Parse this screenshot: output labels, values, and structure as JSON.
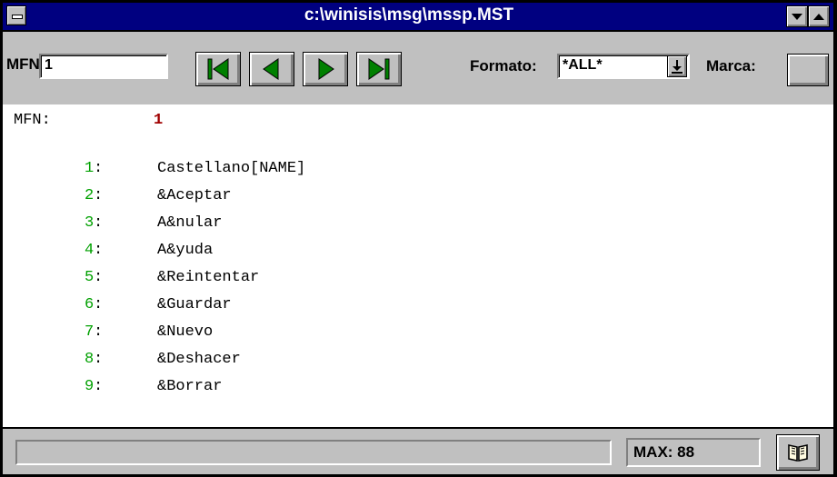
{
  "window": {
    "title": "c:\\winisis\\msg\\mssp.MST"
  },
  "toolbar": {
    "mfn_label": "MFN",
    "mfn_value": "1",
    "nav_buttons": [
      "first-record",
      "previous-record",
      "next-record",
      "last-record"
    ],
    "format_label": "Formato:",
    "format_value": "*ALL*",
    "marca_label": "Marca:"
  },
  "record": {
    "mfn_label": "MFN:",
    "mfn_value": "1",
    "fields": [
      {
        "tag": "1",
        "colon": ":",
        "value": "Castellano[NAME]"
      },
      {
        "tag": "2",
        "colon": ":",
        "value": "&Aceptar"
      },
      {
        "tag": "3",
        "colon": ":",
        "value": "A&nular"
      },
      {
        "tag": "4",
        "colon": ":",
        "value": "A&yuda"
      },
      {
        "tag": "5",
        "colon": ":",
        "value": "&Reintentar"
      },
      {
        "tag": "6",
        "colon": ":",
        "value": "&Guardar"
      },
      {
        "tag": "7",
        "colon": ":",
        "value": "&Nuevo"
      },
      {
        "tag": "8",
        "colon": ":",
        "value": "&Deshacer"
      },
      {
        "tag": "9",
        "colon": ":",
        "value": "&Borrar"
      }
    ]
  },
  "statusbar": {
    "status_text": "",
    "max_text": "MAX: 88"
  },
  "colors": {
    "title_bar": "#000080",
    "nav_arrow": "#008000",
    "tag_text": "#00a000",
    "mfn_value": "#a00000",
    "face": "#c0c0c0"
  }
}
